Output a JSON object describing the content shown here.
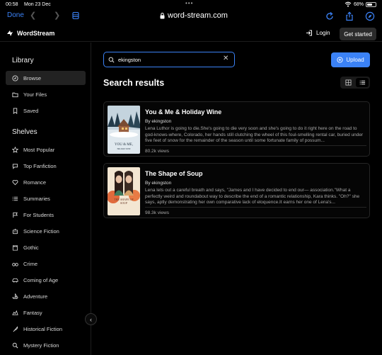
{
  "status": {
    "time": "00:58",
    "date": "Mon 23 Dec",
    "battery": "68%",
    "battery_level": 0.68
  },
  "browser": {
    "done": "Done",
    "url": "word-stream.com"
  },
  "app": {
    "name": "WordStream",
    "login": "Login",
    "get_started": "Get started"
  },
  "sidebar": {
    "library_title": "Library",
    "library": [
      {
        "label": "Browse",
        "icon": "compass-icon"
      },
      {
        "label": "Your Files",
        "icon": "folder-icon"
      },
      {
        "label": "Saved",
        "icon": "bookmark-icon"
      }
    ],
    "shelves_title": "Shelves",
    "shelves": [
      {
        "label": "Most Popular",
        "icon": "star-icon"
      },
      {
        "label": "Top Fanfiction",
        "icon": "chat-icon"
      },
      {
        "label": "Romance",
        "icon": "hearts-icon"
      },
      {
        "label": "Summaries",
        "icon": "list-icon"
      },
      {
        "label": "For Students",
        "icon": "flag-icon"
      },
      {
        "label": "Science Fiction",
        "icon": "robot-icon"
      },
      {
        "label": "Gothic",
        "icon": "castle-icon"
      },
      {
        "label": "Crime",
        "icon": "glasses-icon"
      },
      {
        "label": "Coming of Age",
        "icon": "car-icon"
      },
      {
        "label": "Adventure",
        "icon": "boat-icon"
      },
      {
        "label": "Fantasy",
        "icon": "dragon-icon"
      },
      {
        "label": "Historical Fiction",
        "icon": "quill-icon"
      },
      {
        "label": "Mystery Fiction",
        "icon": "magnifier-icon"
      }
    ]
  },
  "search": {
    "value": "ekingston",
    "placeholder": ""
  },
  "upload_label": "Upload",
  "results_title": "Search results",
  "results": [
    {
      "title": "You & Me & Holiday Wine",
      "author": "By ekingston",
      "description": "Lena Luthor is going to die.She's going to die very soon and she's going to do it right here on the road to god-knows-where, Colorado, her hands still clutching the wheel of this foul-smelling rental car, buried under five feet of snow for the remainder of the season until some fortunate family of possum...",
      "views": "80.2k views",
      "cover_text": "YOU & ME,",
      "cover_sub": "HOLIDAY WINE"
    },
    {
      "title": "The Shape of Soup",
      "author": "By ekingston",
      "description": "Lena lets out a careful breath and says, \"James and I have decided to end our— association.\"What a perfectly weird and roundabout way to describe the end of a romantic relationship, Kara thinks. \"Oh?\" she says, aptly demonstrating her own comparative lack of eloquence.It earns her one of Lena's...",
      "views": "98.3k views",
      "cover_text": "THE SHAPE OF SOUP"
    }
  ],
  "colors": {
    "accent": "#3b82f6",
    "background": "#000000"
  }
}
